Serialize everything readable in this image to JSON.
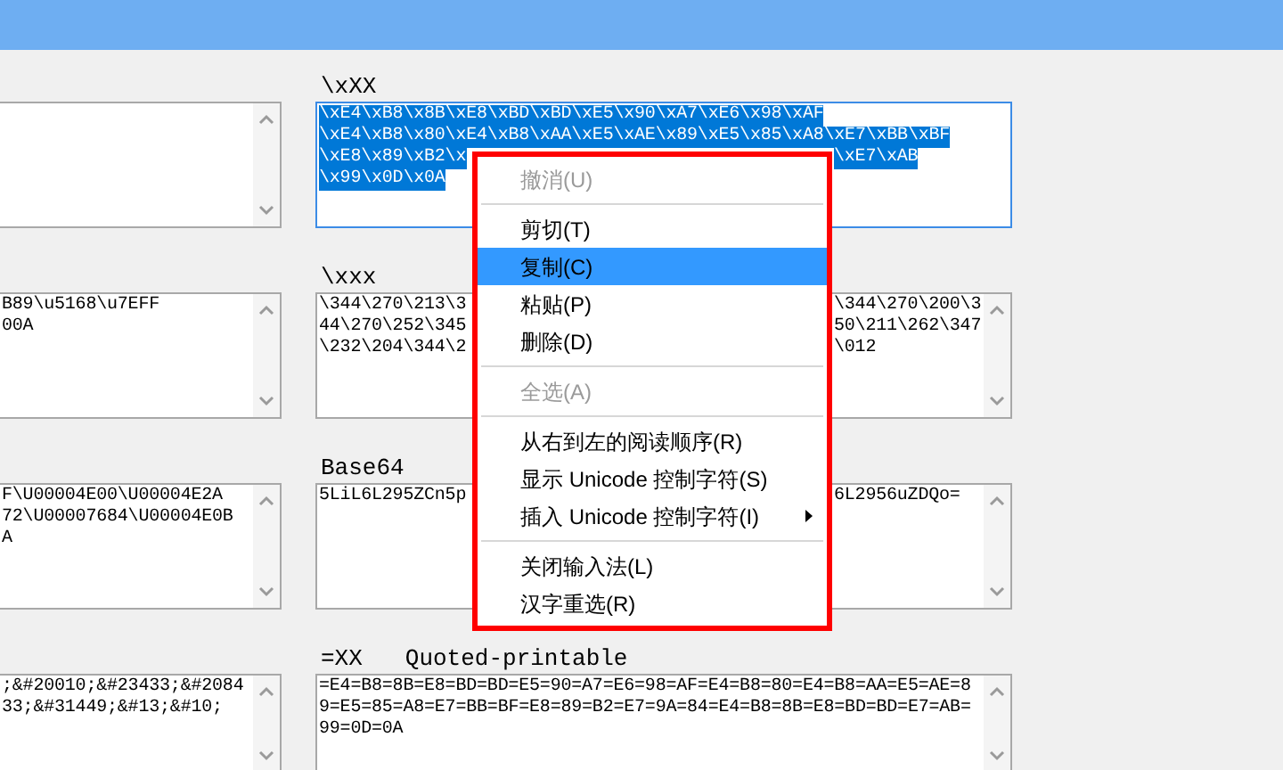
{
  "columns": [
    {
      "boxes": [
        {
          "focused": false,
          "scrollbar": true
        },
        {
          "selected": false,
          "focused": false,
          "scrollbar": true,
          "lines": [
            {
              "left": "B89\\u5168\\u7EFF"
            },
            {
              "left": "00A"
            }
          ]
        },
        {
          "selected": false,
          "focused": false,
          "scrollbar": true,
          "lines": [
            {
              "left": "F\\U00004E00\\U00004E2A"
            },
            {
              "left": "72\\U00007684\\U00004E0B"
            },
            {
              "left": "A"
            }
          ]
        },
        {
          "selected": false,
          "focused": false,
          "scrollbar": true,
          "lines": [
            {
              "left": ";&#20010;&#23433;&#2084"
            },
            {
              "left": "33;&#31449;&#13;&#10;"
            }
          ]
        }
      ]
    },
    {
      "boxes": [
        {
          "label": "\\xXX",
          "selected": true,
          "focused": true,
          "scrollbar": false,
          "lines": [
            {
              "left": "\\xE4\\xB8\\x8B\\xE8\\xBD\\xBD\\xE5\\x90\\xA7\\xE6\\x98\\xAF"
            },
            {
              "left": "\\xE4\\xB8\\x80\\xE4\\xB8\\xAA\\xE5\\xAE\\x89\\xE5\\x85\\xA8\\xE7\\xBB\\xBF"
            },
            {
              "left": "\\xE8\\x89\\xB2\\x",
              "right": "\\xE7\\xAB"
            },
            {
              "left": "\\x99\\x0D\\x0A"
            }
          ]
        },
        {
          "label": "\\xxx",
          "selected": false,
          "focused": false,
          "scrollbar": true,
          "lines": [
            {
              "left": "\\344\\270\\213\\3",
              "right": "\\344\\270\\200\\3"
            },
            {
              "left": "44\\270\\252\\345",
              "right": "50\\211\\262\\347"
            },
            {
              "left": "\\232\\204\\344\\2",
              "right": "\\012"
            }
          ]
        },
        {
          "label": "Base64",
          "selected": false,
          "focused": false,
          "scrollbar": true,
          "lines": [
            {
              "left": "5LiL6L295ZCn5p",
              "right": "6L2956uZDQo="
            }
          ]
        },
        {
          "label": "=XX",
          "label_2": "Quoted-printable",
          "selected": false,
          "focused": false,
          "scrollbar": true,
          "lines": [
            {
              "left": "=E4=B8=8B=E8=BD=BD=E5=90=A7=E6=98=AF=E4=B8=80=E4=B8=AA=E5=AE=8"
            },
            {
              "left": "9=E5=85=A8=E7=BB=BF=E8=89=B2=E7=9A=84=E4=B8=8B=E8=BD=BD=E7=AB="
            },
            {
              "left": "99=0D=0A"
            }
          ]
        }
      ]
    }
  ],
  "context_menu": {
    "items": [
      {
        "kind": "item",
        "label": "撤消(U)",
        "disabled": true,
        "selected": false
      },
      {
        "kind": "separator"
      },
      {
        "kind": "item",
        "label": "剪切(T)",
        "disabled": false,
        "selected": false
      },
      {
        "kind": "item",
        "label": "复制(C)",
        "disabled": false,
        "selected": true
      },
      {
        "kind": "item",
        "label": "粘贴(P)",
        "disabled": false,
        "selected": false
      },
      {
        "kind": "item",
        "label": "删除(D)",
        "disabled": false,
        "selected": false
      },
      {
        "kind": "separator"
      },
      {
        "kind": "item",
        "label": "全选(A)",
        "disabled": true,
        "selected": false
      },
      {
        "kind": "separator"
      },
      {
        "kind": "item",
        "label": "从右到左的阅读顺序(R)",
        "disabled": false,
        "selected": false
      },
      {
        "kind": "item",
        "label": "显示 Unicode 控制字符(S)",
        "disabled": false,
        "selected": false
      },
      {
        "kind": "item",
        "label": "插入 Unicode 控制字符(I)",
        "disabled": false,
        "selected": false,
        "submenu": true
      },
      {
        "kind": "separator"
      },
      {
        "kind": "item",
        "label": "关闭输入法(L)",
        "disabled": false,
        "selected": false
      },
      {
        "kind": "item",
        "label": "汉字重选(R)",
        "disabled": false,
        "selected": false
      }
    ]
  }
}
